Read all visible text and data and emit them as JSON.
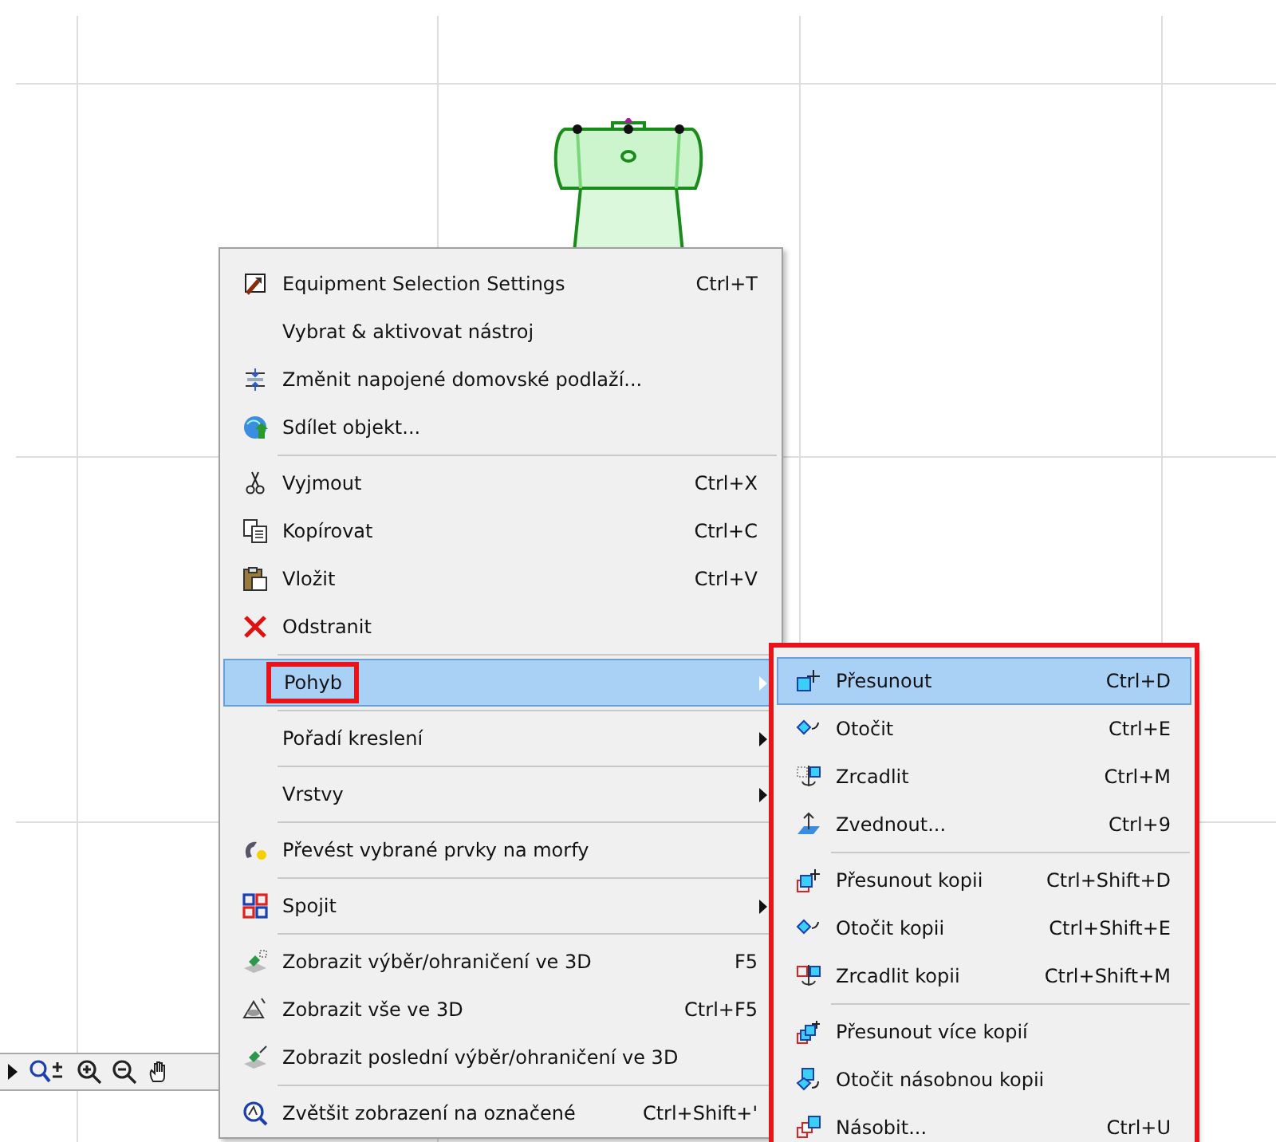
{
  "context_menu": {
    "items": [
      {
        "label": "Equipment Selection Settings",
        "shortcut": "Ctrl+T",
        "separator_before": false,
        "submenu": false,
        "selected": false,
        "marked": false
      },
      {
        "label": "Vybrat & aktivovat nástroj",
        "separator_before": false,
        "submenu": false,
        "selected": false,
        "marked": false
      },
      {
        "label": "Změnit napojené domovské podlaží...",
        "separator_before": false,
        "submenu": false,
        "selected": false,
        "marked": false
      },
      {
        "label": "Sdílet objekt...",
        "separator_before": false,
        "submenu": false,
        "selected": false,
        "marked": false
      },
      {
        "label": "Vyjmout",
        "shortcut": "Ctrl+X",
        "separator_before": true,
        "submenu": false,
        "selected": false,
        "marked": false
      },
      {
        "label": "Kopírovat",
        "shortcut": "Ctrl+C",
        "separator_before": false,
        "submenu": false,
        "selected": false,
        "marked": false
      },
      {
        "label": "Vložit",
        "shortcut": "Ctrl+V",
        "separator_before": false,
        "submenu": false,
        "selected": false,
        "marked": false
      },
      {
        "label": "Odstranit",
        "separator_before": false,
        "submenu": false,
        "selected": false,
        "marked": false
      },
      {
        "label": "Pohyb",
        "separator_before": true,
        "submenu": true,
        "selected": true,
        "marked": true
      },
      {
        "label": "Pořadí kreslení",
        "separator_before": true,
        "submenu": true,
        "selected": false,
        "marked": false
      },
      {
        "label": "Vrstvy",
        "separator_before": true,
        "submenu": true,
        "selected": false,
        "marked": false
      },
      {
        "label": "Převést vybrané prvky na morfy",
        "separator_before": true,
        "submenu": false,
        "selected": false,
        "marked": false
      },
      {
        "label": "Spojit",
        "separator_before": true,
        "submenu": true,
        "selected": false,
        "marked": false
      },
      {
        "label": "Zobrazit výběr/ohraničení ve 3D",
        "shortcut": "F5",
        "separator_before": true,
        "submenu": false,
        "selected": false,
        "marked": false
      },
      {
        "label": "Zobrazit vše ve 3D",
        "shortcut": "Ctrl+F5",
        "separator_before": false,
        "submenu": false,
        "selected": false,
        "marked": false
      },
      {
        "label": "Zobrazit poslední výběr/ohraničení ve 3D",
        "separator_before": false,
        "submenu": false,
        "selected": false,
        "marked": false
      },
      {
        "label": "Zvětšit zobrazení na označené",
        "shortcut": "Ctrl+Shift+'",
        "separator_before": true,
        "submenu": false,
        "selected": false,
        "marked": false
      }
    ]
  },
  "submenu": {
    "marked": true,
    "items": [
      {
        "label": "Přesunout",
        "shortcut": "Ctrl+D",
        "separator_before": false,
        "selected": true
      },
      {
        "label": "Otočit",
        "shortcut": "Ctrl+E",
        "separator_before": false,
        "selected": false
      },
      {
        "label": "Zrcadlit",
        "shortcut": "Ctrl+M",
        "separator_before": false,
        "selected": false
      },
      {
        "label": "Zvednout...",
        "shortcut": "Ctrl+9",
        "separator_before": false,
        "selected": false
      },
      {
        "label": "Přesunout kopii",
        "shortcut": "Ctrl+Shift+D",
        "separator_before": true,
        "selected": false
      },
      {
        "label": "Otočit kopii",
        "shortcut": "Ctrl+Shift+E",
        "separator_before": false,
        "selected": false
      },
      {
        "label": "Zrcadlit kopii",
        "shortcut": "Ctrl+Shift+M",
        "separator_before": false,
        "selected": false
      },
      {
        "label": "Přesunout více kopií",
        "separator_before": true,
        "selected": false
      },
      {
        "label": "Otočit násobnou kopii",
        "separator_before": false,
        "selected": false
      },
      {
        "label": "Násobit...",
        "shortcut": "Ctrl+U",
        "separator_before": false,
        "selected": false
      }
    ]
  }
}
